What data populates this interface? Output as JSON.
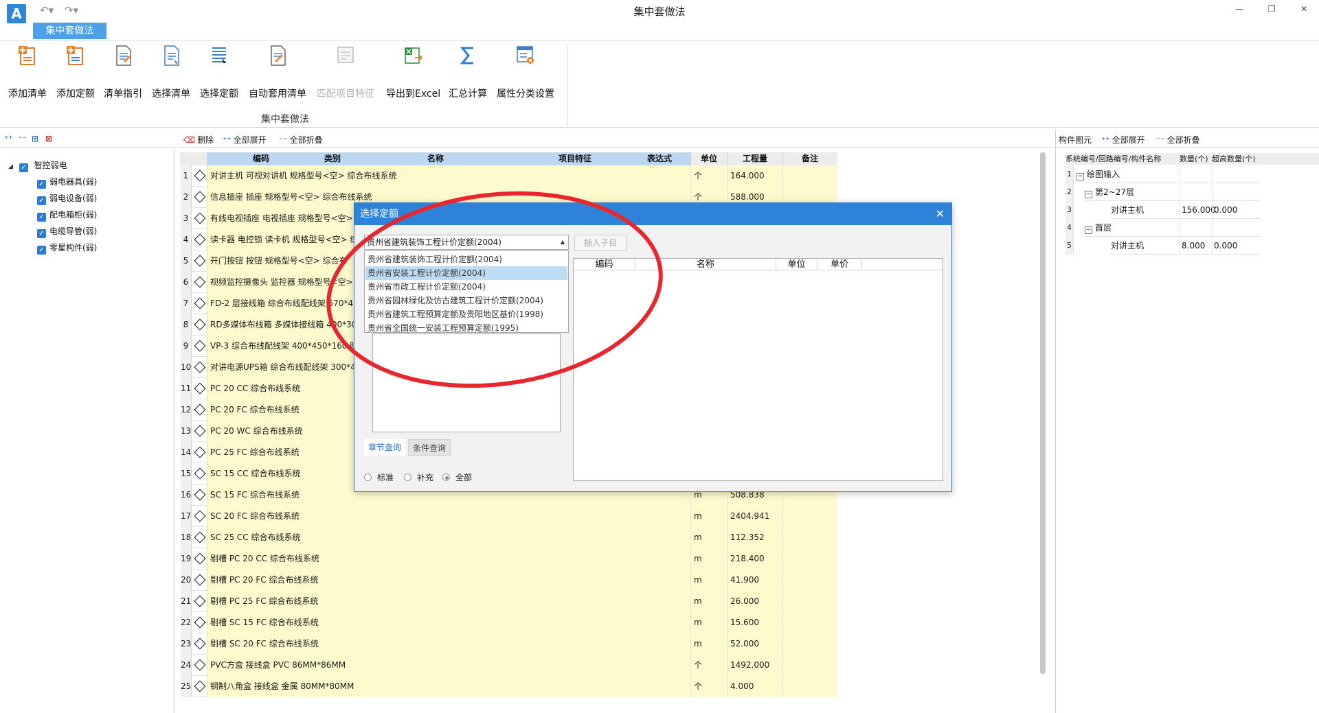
{
  "window": {
    "title": "集中套做法",
    "app_logo": "A"
  },
  "quick_access": {
    "undo_icon": "undo-icon",
    "redo_icon": "redo-icon"
  },
  "ribbon": {
    "active_tab": "集中套做法",
    "group_label": "集中套做法",
    "buttons": [
      {
        "label": "添加清单",
        "icon": "add-list-icon",
        "enabled": true
      },
      {
        "label": "添加定额",
        "icon": "add-quota-icon",
        "enabled": true
      },
      {
        "label": "清单指引",
        "icon": "list-guide-icon",
        "enabled": true
      },
      {
        "label": "选择清单",
        "icon": "select-list-icon",
        "enabled": true
      },
      {
        "label": "选择定额",
        "icon": "select-quota-icon",
        "enabled": true
      },
      {
        "label": "自动套用清单",
        "icon": "auto-apply-icon",
        "enabled": true
      },
      {
        "label": "匹配项目特征",
        "icon": "match-feature-icon",
        "enabled": false
      },
      {
        "label": "导出到Excel",
        "icon": "export-excel-icon",
        "enabled": true
      },
      {
        "label": "汇总计算",
        "icon": "sigma-icon",
        "enabled": true
      },
      {
        "label": "属性分类设置",
        "icon": "property-settings-icon",
        "enabled": true
      }
    ]
  },
  "grid_toolbar": {
    "delete": "删除",
    "expand_all": "全部展开",
    "collapse_all": "全部折叠"
  },
  "left_tree": {
    "root": "智控弱电",
    "items": [
      "弱电器具(弱)",
      "弱电设备(弱)",
      "配电箱柜(弱)",
      "电缆导管(弱)",
      "零星构件(弱)"
    ]
  },
  "grid": {
    "columns": [
      "编码",
      "类别",
      "名称",
      "项目特征",
      "表达式",
      "单位",
      "工程量",
      "备注"
    ],
    "rows": [
      {
        "n": "1",
        "desc": "对讲主机 可视对讲机 规格型号<空> 综合布线系统",
        "unit": "个",
        "qty": "164.000"
      },
      {
        "n": "2",
        "desc": "信息插座 插座 规格型号<空> 综合布线系统",
        "unit": "个",
        "qty": "588.000"
      },
      {
        "n": "3",
        "desc": "有线电视插座 电视插座 规格型号<空>",
        "unit": "",
        "qty": ""
      },
      {
        "n": "4",
        "desc": "读卡器 电控锁 读卡机 规格型号<空> 综",
        "unit": "",
        "qty": ""
      },
      {
        "n": "5",
        "desc": "开门按钮 按钮 规格型号<空> 综合布",
        "unit": "",
        "qty": ""
      },
      {
        "n": "6",
        "desc": "视频监控摄像头 监控器 规格型号<空>",
        "unit": "",
        "qty": ""
      },
      {
        "n": "7",
        "desc": "FD-2 层接线箱 综合布线配线架 570*49",
        "unit": "",
        "qty": ""
      },
      {
        "n": "8",
        "desc": "RD多媒体布线箱 多媒体接线箱 400*30",
        "unit": "",
        "qty": ""
      },
      {
        "n": "9",
        "desc": "VP-3 综合布线配线架 400*450*160 明",
        "unit": "",
        "qty": ""
      },
      {
        "n": "10",
        "desc": "对讲电源UPS箱 综合布线配线架 300*4",
        "unit": "",
        "qty": ""
      },
      {
        "n": "11",
        "desc": "PC 20 CC 综合布线系统",
        "unit": "",
        "qty": ""
      },
      {
        "n": "12",
        "desc": "PC 20 FC 综合布线系统",
        "unit": "",
        "qty": ""
      },
      {
        "n": "13",
        "desc": "PC 20 WC 综合布线系统",
        "unit": "",
        "qty": ""
      },
      {
        "n": "14",
        "desc": "PC 25 FC 综合布线系统",
        "unit": "",
        "qty": ""
      },
      {
        "n": "15",
        "desc": "SC 15 CC 综合布线系统",
        "unit": "",
        "qty": ""
      },
      {
        "n": "16",
        "desc": "SC 15 FC 综合布线系统",
        "unit": "m",
        "qty": "508.838"
      },
      {
        "n": "17",
        "desc": "SC 20 FC 综合布线系统",
        "unit": "m",
        "qty": "2404.941"
      },
      {
        "n": "18",
        "desc": "SC 25 CC 综合布线系统",
        "unit": "m",
        "qty": "112.352"
      },
      {
        "n": "19",
        "desc": "剔槽 PC 20 CC 综合布线系统",
        "unit": "m",
        "qty": "218.400"
      },
      {
        "n": "20",
        "desc": "剔槽 PC 20 FC 综合布线系统",
        "unit": "m",
        "qty": "41.900"
      },
      {
        "n": "21",
        "desc": "剔槽 PC 25 FC 综合布线系统",
        "unit": "m",
        "qty": "26.000"
      },
      {
        "n": "22",
        "desc": "剔槽 SC 15 FC 综合布线系统",
        "unit": "m",
        "qty": "15.600"
      },
      {
        "n": "23",
        "desc": "剔槽 SC 20 FC 综合布线系统",
        "unit": "m",
        "qty": "52.000"
      },
      {
        "n": "24",
        "desc": "PVC方盒 接线盒 PVC 86MM*86MM",
        "unit": "个",
        "qty": "1492.000"
      },
      {
        "n": "25",
        "desc": "钢制八角盒 接线盒 金属 80MM*80MM",
        "unit": "个",
        "qty": "4.000"
      }
    ]
  },
  "right_panel": {
    "toolbar": {
      "title": "构件图元",
      "expand_all": "全部展开",
      "collapse_all": "全部折叠"
    },
    "columns": [
      "系统编号/回路编号/构件名称",
      "数量(个)",
      "超高数量(个)"
    ],
    "rows": [
      {
        "n": "1",
        "name": "绘图输入",
        "qty": "",
        "extra": "",
        "toggle": "−",
        "indent": 0
      },
      {
        "n": "2",
        "name": "第2~27层",
        "qty": "",
        "extra": "",
        "toggle": "−",
        "indent": 1
      },
      {
        "n": "3",
        "name": "对讲主机",
        "qty": "156.000",
        "extra": "0.000",
        "toggle": "",
        "indent": 2
      },
      {
        "n": "4",
        "name": "首层",
        "qty": "",
        "extra": "",
        "toggle": "−",
        "indent": 1
      },
      {
        "n": "5",
        "name": "对讲主机",
        "qty": "8.000",
        "extra": "0.000",
        "toggle": "",
        "indent": 2
      }
    ]
  },
  "dialog": {
    "title": "选择定额",
    "close_icon": "close-icon",
    "combo_value": "贵州省建筑装饰工程计价定额(2004)",
    "options": [
      "贵州省建筑装饰工程计价定额(2004)",
      "贵州省安装工程计价定额(2004)",
      "贵州省市政工程计价定额(2004)",
      "贵州省园林绿化及仿古建筑工程计价定额(2004)",
      "贵州省建筑工程预算定额及贵阳地区基价(1998)",
      "贵州省全国统一安装工程预算定额(1995)"
    ],
    "selected_option_index": 1,
    "insert_button": "插入子目",
    "result_columns": [
      "编码",
      "名称",
      "单位",
      "单价"
    ],
    "tabs": [
      "章节查询",
      "条件查询"
    ],
    "radios": [
      {
        "label": "标准",
        "checked": false
      },
      {
        "label": "补充",
        "checked": false
      },
      {
        "label": "全部",
        "checked": true
      }
    ]
  },
  "colors": {
    "accent": "#2e83d9",
    "row_fill": "#fdfbce",
    "header_blue": "#bcd7f2",
    "annotation_red": "#e8262d"
  }
}
